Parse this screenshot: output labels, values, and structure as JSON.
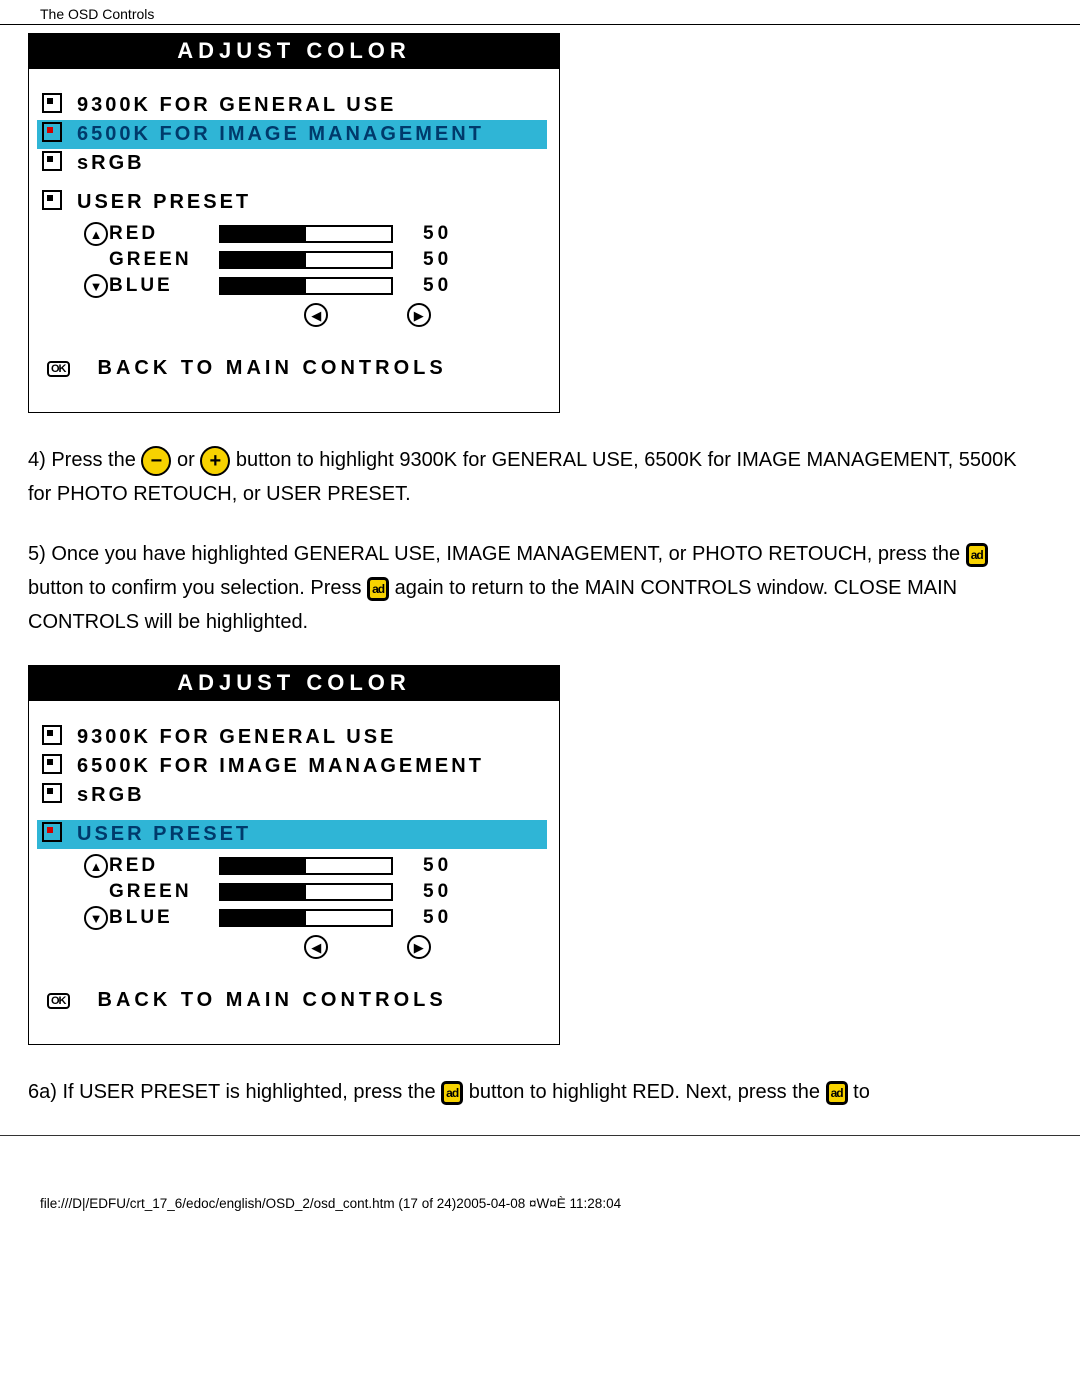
{
  "header": {
    "title": "The OSD Controls"
  },
  "osd": {
    "title": "ADJUST COLOR",
    "items": {
      "i9300": "9300K FOR GENERAL USE",
      "i6500": "6500K FOR IMAGE MANAGEMENT",
      "srgb": "sRGB",
      "user": "USER PRESET"
    },
    "rgb": {
      "red": {
        "name": "RED",
        "value": "50",
        "pct": 50
      },
      "green": {
        "name": "GREEN",
        "value": "50",
        "pct": 50
      },
      "blue": {
        "name": "BLUE",
        "value": "50",
        "pct": 50
      }
    },
    "back": "BACK TO MAIN CONTROLS",
    "ok": "OK"
  },
  "buttons": {
    "minus": "−",
    "plus": "+",
    "ok": "ad"
  },
  "step4": {
    "a": "4) Press the ",
    "b": " or ",
    "c": " button to highlight 9300K for GENERAL USE, 6500K for IMAGE MANAGEMENT, 5500K for PHOTO RETOUCH, or USER PRESET."
  },
  "step5": {
    "a": "5) Once you have highlighted GENERAL USE, IMAGE MANAGEMENT, or PHOTO RETOUCH, press the ",
    "b": " button to confirm you selection. Press ",
    "c": " again to return to the MAIN CONTROLS window. CLOSE MAIN CONTROLS will be highlighted."
  },
  "step6a": {
    "a": "6a) If USER PRESET is highlighted, press the ",
    "b": " button to highlight RED. Next, press the ",
    "c": " to"
  },
  "footer": "file:///D|/EDFU/crt_17_6/edoc/english/OSD_2/osd_cont.htm (17 of 24)2005-04-08 ¤W¤È 11:28:04"
}
